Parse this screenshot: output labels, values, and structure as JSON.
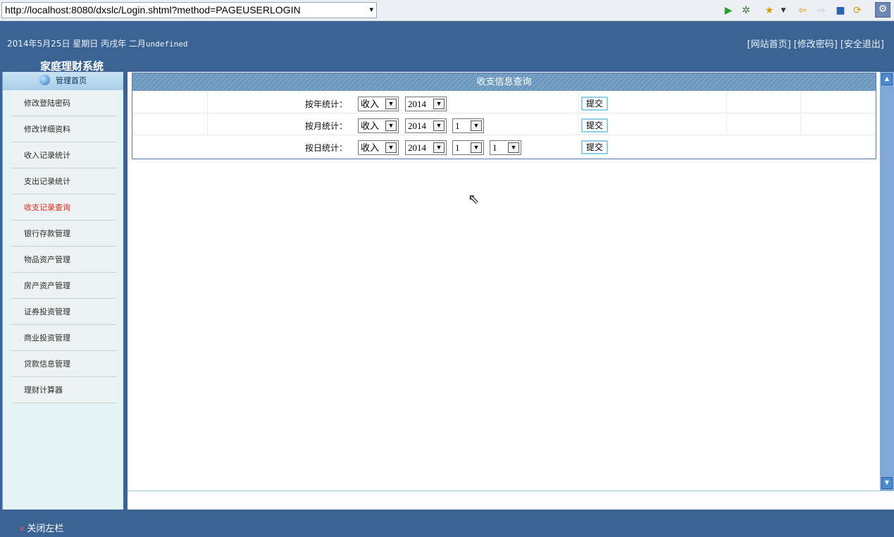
{
  "browser": {
    "url": "http://localhost:8080/dxslc/Login.shtml?method=PAGEUSERLOGIN",
    "dropdown_glyph": "▾",
    "icons": [
      "run-icon",
      "debug-icon",
      "favorites-icon",
      "back-icon",
      "forward-icon",
      "stop-icon",
      "refresh-icon",
      "settings-icon"
    ]
  },
  "header": {
    "date_prefix": "2014年5月25日 星期日 丙戌年 二月",
    "date_suffix": "undefined",
    "app_title": "家庭理财系统",
    "links": [
      "[网站首页]",
      "[修改密码]",
      "[安全退出]"
    ]
  },
  "sidebar": {
    "head": "管理首页",
    "items": [
      {
        "label": "修改登陆密码"
      },
      {
        "label": "修改详细资料"
      },
      {
        "label": "收入记录统计"
      },
      {
        "label": "支出记录统计"
      },
      {
        "label": "收支记录查询",
        "active": true
      },
      {
        "label": "银行存款管理"
      },
      {
        "label": "物品资产管理"
      },
      {
        "label": "房产资产管理"
      },
      {
        "label": "证券投资管理"
      },
      {
        "label": "商业投资管理"
      },
      {
        "label": "贷款信息管理"
      },
      {
        "label": "理财计算器"
      }
    ]
  },
  "panel": {
    "title": "收支信息查询",
    "rows": [
      {
        "label": "按年统计：",
        "type": "收入",
        "year": "2014",
        "submit": "提交"
      },
      {
        "label": "按月统计：",
        "type": "收入",
        "year": "2014",
        "month": "1",
        "submit": "提交"
      },
      {
        "label": "按日统计：",
        "type": "收入",
        "year": "2014",
        "month": "1",
        "day": "1",
        "submit": "提交"
      }
    ]
  },
  "footer": {
    "close_sidebar": "关闭左栏"
  },
  "colors": {
    "header_bg": "#3b6494",
    "sidebar_bg": "#e4f3f4",
    "active_item": "#e2231a",
    "panel_border": "#4d7fb3"
  }
}
